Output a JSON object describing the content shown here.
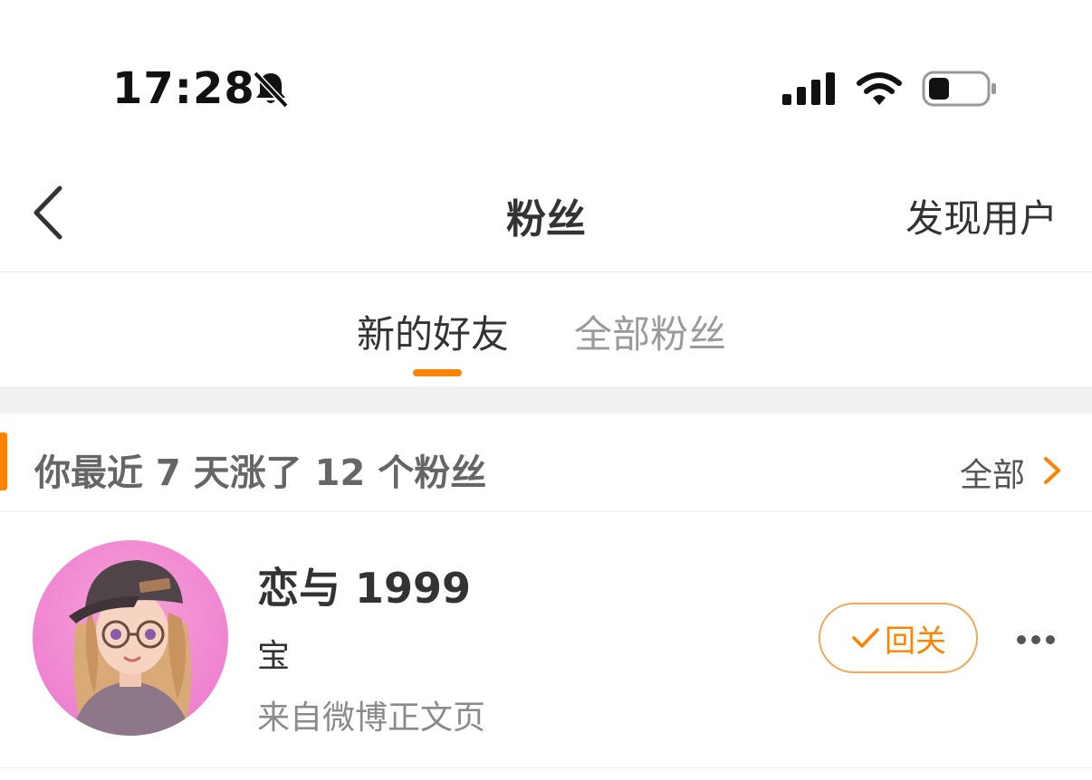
{
  "status_bar": {
    "time": "17:28",
    "icons": [
      "bell-slash-icon",
      "signal-icon",
      "wifi-icon",
      "battery-icon"
    ]
  },
  "nav": {
    "back_icon": "chevron-left-icon",
    "title": "粉丝",
    "discover_label": "发现用户"
  },
  "tabs": [
    {
      "label": "新的好友",
      "active": true
    },
    {
      "label": "全部粉丝",
      "active": false
    }
  ],
  "section": {
    "title": "你最近 7 天涨了 12 个粉丝",
    "all_label": "全部",
    "chevron_icon": "chevron-right-icon"
  },
  "users": [
    {
      "name": "恋与 1999",
      "remark": "宝",
      "source": "来自微博正文页",
      "follow_label": "回关",
      "more_icon": "more-dots-icon"
    }
  ],
  "colors": {
    "accent": "#ff8200",
    "text_primary": "#333333",
    "text_secondary": "#9a9a9a",
    "separator": "#f1f1f1"
  }
}
